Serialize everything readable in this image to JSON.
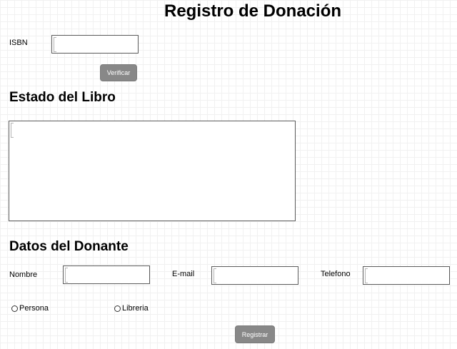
{
  "page_title": "Registro de Donación",
  "isbn": {
    "label": "ISBN",
    "value": "",
    "verify_label": "Verificar"
  },
  "book_state": {
    "heading": "Estado del Libro",
    "value": ""
  },
  "donor": {
    "heading": "Datos del Donante",
    "name_label": "Nombre",
    "name_value": "",
    "email_label": "E-mail",
    "email_value": "",
    "phone_label": "Telefono",
    "phone_value": "",
    "type_options": [
      "Persona",
      "Libreria"
    ],
    "submit_label": "Registrar"
  }
}
